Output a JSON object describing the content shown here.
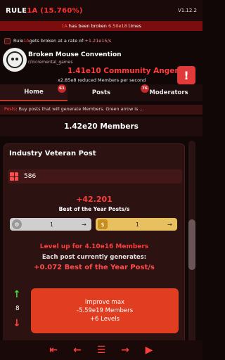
{
  "app": {
    "name_prefix": "RULE",
    "name_suffix": "1A",
    "percent": "(15.760%)",
    "version": "V1.12.2"
  },
  "broken": {
    "prefix": "1A",
    "middle": " has been broken ",
    "count": "6.50e18",
    "suffix": " times"
  },
  "rate": {
    "prefix": "Rule ",
    "rule": "1A",
    "middle": " gets broken at a rate of: ",
    "value": "+1.21e15/s"
  },
  "community": {
    "name": "Broken Mouse Convention",
    "sub": "r/incremental_games",
    "anger": "1.41e10 Community Anger",
    "reduced": "x2.85e8 reduced Members per second",
    "anger_icon": "angry-face-icon"
  },
  "tabs": [
    {
      "label": "Home",
      "badge": "61"
    },
    {
      "label": "Posts",
      "badge": ""
    },
    {
      "label": "Moderators",
      "badge": "76"
    }
  ],
  "info": {
    "prefix": "Posts",
    "text": ": Buy posts that will generate Members. Green arrow is ..."
  },
  "members": "1.42e20 Members",
  "card": {
    "title": "Industry Veteran Post",
    "count": "586",
    "rate": "+42.201",
    "rate_label": "Best of the Year Posts/s",
    "pill_left": {
      "value": "1",
      "icon": "gear-cap-icon",
      "arrow": "→"
    },
    "pill_right": {
      "value": "1",
      "icon": "coin-icon",
      "arrow": "→"
    },
    "levelup": "Level up for 4.10e16 Members",
    "each_post": "Each post currently generates:",
    "generates": "+0.072 Best of the Year Post/s",
    "buy_count": "8",
    "improve": {
      "line1": "Improve max",
      "line2": "-5.59e19 Members",
      "line3": "+6 Levels"
    }
  },
  "nav": {
    "first": "⇤",
    "back": "←",
    "menu": "☰",
    "forward": "→",
    "play": "▶"
  },
  "colors": {
    "accent": "#ff3d3d",
    "background": "#120707",
    "card": "#2d1212",
    "button": "#e13d20",
    "up": "#3fd33f"
  }
}
